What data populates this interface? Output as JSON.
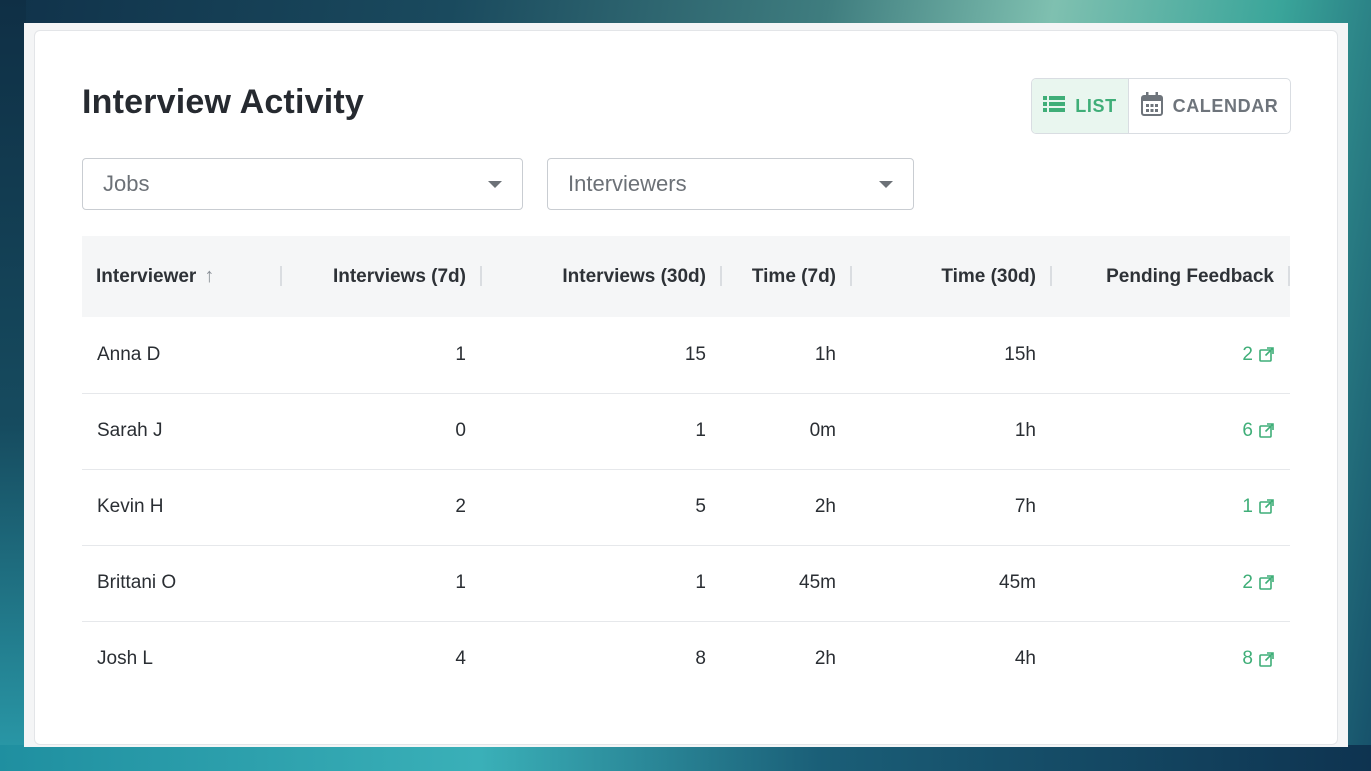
{
  "title": "Interview Activity",
  "view_toggle": {
    "list_label": "LIST",
    "calendar_label": "CALENDAR",
    "active": "LIST"
  },
  "filters": {
    "jobs_placeholder": "Jobs",
    "interviewers_placeholder": "Interviewers"
  },
  "table": {
    "headers": [
      "Interviewer",
      "Interviews (7d)",
      "Interviews (30d)",
      "Time (7d)",
      "Time (30d)",
      "Pending Feedback"
    ],
    "sort_icon": "arrow-up-icon",
    "rows": [
      {
        "interviewer": "Anna D",
        "interviews_7d": "1",
        "interviews_30d": "15",
        "time_7d": "1h",
        "time_30d": "15h",
        "pending_feedback": "2"
      },
      {
        "interviewer": "Sarah J",
        "interviews_7d": "0",
        "interviews_30d": "1",
        "time_7d": "0m",
        "time_30d": "1h",
        "pending_feedback": "6"
      },
      {
        "interviewer": "Kevin H",
        "interviews_7d": "2",
        "interviews_30d": "5",
        "time_7d": "2h",
        "time_30d": "7h",
        "pending_feedback": "1"
      },
      {
        "interviewer": "Brittani O",
        "interviews_7d": "1",
        "interviews_30d": "1",
        "time_7d": "45m",
        "time_30d": "45m",
        "pending_feedback": "2"
      },
      {
        "interviewer": "Josh L",
        "interviews_7d": "4",
        "interviews_30d": "8",
        "time_7d": "2h",
        "time_30d": "4h",
        "pending_feedback": "8"
      }
    ]
  },
  "colors": {
    "accent": "#3fae78",
    "text": "#2a2e33",
    "header_bg": "#f5f6f7"
  }
}
